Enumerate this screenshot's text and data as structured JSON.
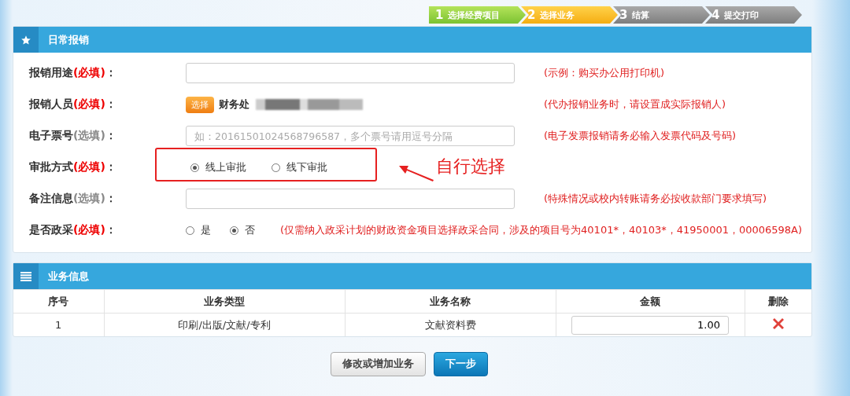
{
  "steps": [
    {
      "number": "1",
      "label": "选择经费项目",
      "kind": "done"
    },
    {
      "number": "2",
      "label": "选择业务",
      "kind": "current"
    },
    {
      "number": "3",
      "label": "结算",
      "kind": "pending"
    },
    {
      "number": "4",
      "label": "提交打印",
      "kind": "pending"
    }
  ],
  "form": {
    "title": "日常报销",
    "rows": [
      {
        "kind": "text",
        "label": "报销用途",
        "requirement": "(必填)",
        "colon": "：",
        "required": true,
        "value": "",
        "hint": "(示例：购买办公用打印机)"
      },
      {
        "kind": "person",
        "label": "报销人员",
        "requirement": "(必填)",
        "colon": "：",
        "required": true,
        "button": "选择",
        "value": "财务处",
        "blurred": true,
        "hint": "(代办报销业务时，请设置成实际报销人)"
      },
      {
        "kind": "text",
        "label": "电子票号",
        "requirement": "(选填)",
        "colon": "：",
        "required": false,
        "placeholder": "如：20161501024568796587，多个票号请用逗号分隔",
        "hint": "(电子发票报销请务必输入发票代码及号码)"
      },
      {
        "kind": "radio",
        "label": "审批方式",
        "requirement": "(必填)",
        "colon": "：",
        "required": true,
        "callout": "自行选择",
        "options": [
          {
            "label": "线上审批",
            "selected": true
          },
          {
            "label": "线下审批",
            "selected": false
          }
        ]
      },
      {
        "kind": "text",
        "label": "备注信息",
        "requirement": "(选填)",
        "colon": "：",
        "required": false,
        "hint": "(特殊情况或校内转账请务必按收款部门要求填写)"
      },
      {
        "kind": "radio",
        "label": "是否政采",
        "requirement": "(必填)",
        "colon": "：",
        "required": true,
        "options": [
          {
            "label": "是",
            "selected": false
          },
          {
            "label": "否",
            "selected": true
          }
        ],
        "hint": "(仅需纳入政采计划的财政资金项目选择政采合同，涉及的项目号为40101*，40103*，41950001，00006598A)"
      }
    ]
  },
  "business": {
    "title": "业务信息",
    "columns": [
      "序号",
      "业务类型",
      "业务名称",
      "金额",
      "删除"
    ],
    "rows": [
      {
        "cells": [
          "1",
          "印刷/出版/文献/专利",
          "文献资料费"
        ],
        "amount": "1.00"
      }
    ]
  },
  "buttons": [
    {
      "label": "修改或增加业务",
      "kind": "secondary"
    },
    {
      "label": "下一步",
      "kind": "primary"
    }
  ]
}
